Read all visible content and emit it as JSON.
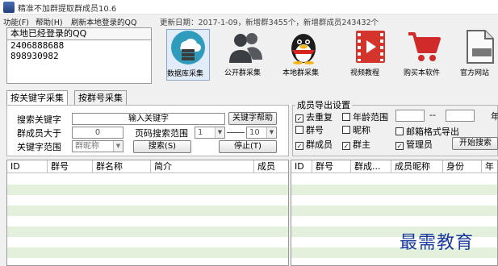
{
  "window": {
    "title": "精准不加群提取群成员10.6"
  },
  "menu": {
    "items": [
      "功能(F)",
      "帮助(H)",
      "刷新本地登录的QQ"
    ],
    "update_text": "更新日期：2017-1-09，新增群3455个，新增群成员243432个"
  },
  "local_qq": {
    "header": "本地已经登录的QQ",
    "accounts": [
      "2406888688",
      "898930982"
    ]
  },
  "toolbar": {
    "db_collect": "数据库采集",
    "public_group": "公开群采集",
    "local_group": "本地群采集",
    "video_tutorial": "视频教程",
    "buy": "购买本软件",
    "official_site": "官方网站"
  },
  "tabs": [
    "按关键字采集",
    "按群号采集"
  ],
  "keyword_form": {
    "search_keyword_label": "搜索关键字",
    "keyword_placeholder": "输入关键字",
    "keyword_help_button": "关键字帮助",
    "member_gt_label": "群成员大于",
    "member_gt_value": "0",
    "page_range_label": "页码搜索范围",
    "page_from": "1",
    "page_to": "10",
    "keyword_range_label": "关键字范围",
    "keyword_range_value": "群昵称",
    "search_button": "搜索(S)",
    "stop_button": "停止(T)"
  },
  "export": {
    "legend": "成员导出设置",
    "dedupe": "去重复",
    "age_range": "年龄范围",
    "age_sep": "--",
    "age_suffix": "年",
    "group_no": "群号",
    "nickname": "昵称",
    "email_format": "邮箱格式导出",
    "group_member": "群成员",
    "group_owner": "群主",
    "admin": "管理员",
    "start_search": "开始搜索"
  },
  "left_table": {
    "columns": [
      "ID",
      "群号",
      "群名称",
      "简介",
      "成员"
    ]
  },
  "right_table": {
    "columns": [
      "ID",
      "群号",
      "群成...",
      "成员昵称",
      "身份",
      "年"
    ]
  },
  "watermark": "最需教育",
  "colors": {
    "row_alt": "#e3f1dc",
    "watermark": "#1a3b9c",
    "play_red": "#d4342a",
    "cart_red": "#d12a2a"
  }
}
